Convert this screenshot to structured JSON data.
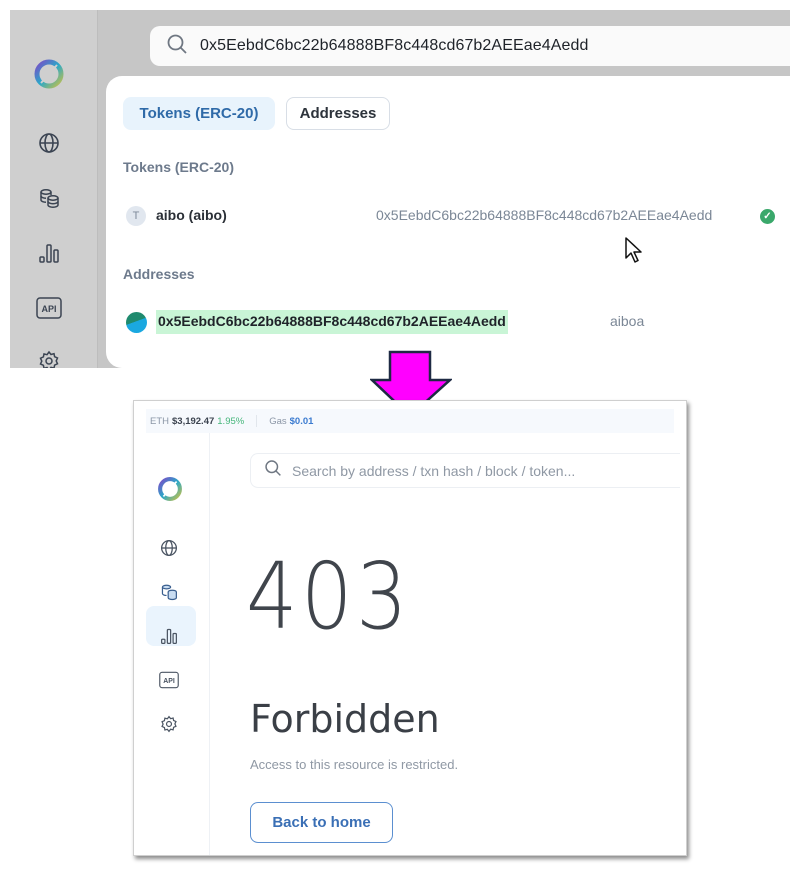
{
  "top_panel": {
    "search_value": "0x5EebdC6bc22b64888BF8c448cd67b2AEEae4Aedd",
    "sidebar_icons": [
      "logo-icon",
      "globe-icon",
      "coins-icon",
      "bar-chart-icon",
      "api-icon",
      "gear-icon"
    ],
    "api_label": "API",
    "tabs": [
      {
        "label": "Tokens (ERC-20)",
        "active": true
      },
      {
        "label": "Addresses",
        "active": false
      }
    ],
    "tokens_section": {
      "heading": "Tokens (ERC-20)",
      "items": [
        {
          "badge": "T",
          "name": "aibo (aibo)",
          "address": "0x5EebdC6bc22b64888BF8c448cd67b2AEEae4Aedd",
          "verified": true
        }
      ]
    },
    "addresses_section": {
      "heading": "Addresses",
      "items": [
        {
          "address": "0x5EebdC6bc22b64888BF8c448cd67b2AEEae4Aedd",
          "label": "aiboa",
          "highlighted": true
        }
      ]
    },
    "check_glyph": "✓"
  },
  "bottom_panel": {
    "ticker": {
      "eth_label": "ETH",
      "eth_price": "$3,192.47",
      "eth_change": "1.95%",
      "gas_label": "Gas",
      "gas_price": "$0.01"
    },
    "search_placeholder": "Search by address / txn hash / block / token...",
    "sidebar_active": "coins-icon",
    "api_label": "API",
    "error_code": "403",
    "error_title": "Forbidden",
    "error_message": "Access to this resource is restricted.",
    "back_button": "Back to home"
  },
  "colors": {
    "accent_blue": "#3a6fb5",
    "arrow_magenta": "#ff00ff",
    "verified_green": "#3aa86b",
    "highlight_green": "#c9f5d6"
  }
}
